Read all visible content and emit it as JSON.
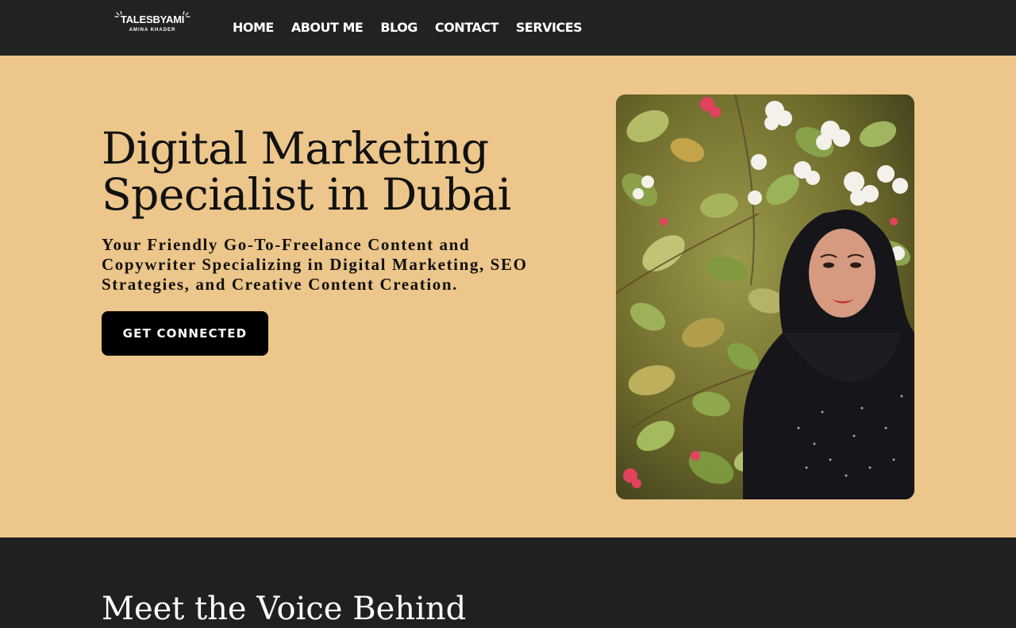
{
  "brand": {
    "logo_main": "TALESBYAMI",
    "logo_sub": "AMINA KHADER"
  },
  "nav": {
    "items": [
      {
        "label": "HOME"
      },
      {
        "label": "ABOUT ME"
      },
      {
        "label": "BLOG"
      },
      {
        "label": "CONTACT"
      },
      {
        "label": "SERVICES"
      }
    ]
  },
  "hero": {
    "title": "Digital Marketing Specialist in Dubai",
    "subtitle": "Your Friendly Go-To-Freelance Content and Copywriter Specializing in Digital Marketing, SEO Strategies, and Creative Content Creation.",
    "cta_label": "GET CONNECTED",
    "photo_icon": "portrait-photo"
  },
  "next_section": {
    "title": "Meet the Voice Behind"
  },
  "colors": {
    "header_bg": "#222222",
    "hero_bg": "#ecc68a",
    "button_bg": "#000000",
    "text_dark": "#111111",
    "text_light": "#ffffff"
  }
}
